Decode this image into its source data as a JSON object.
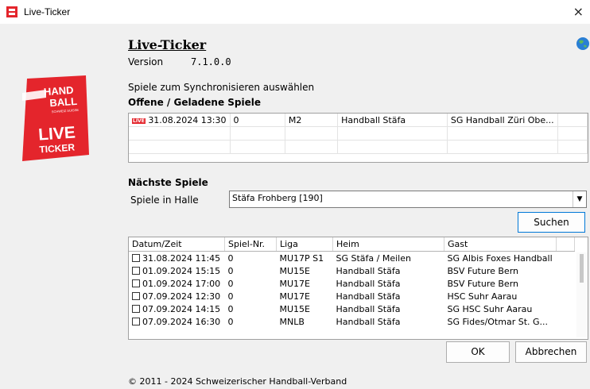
{
  "window": {
    "title": "Live-Ticker",
    "close_glyph": "×"
  },
  "header": {
    "title": "Live-Ticker",
    "version_label": "Version",
    "version_value": "7.1.0.0"
  },
  "logo": {
    "top": "HAND",
    "bottom": "BALL",
    "sub": "SCHWEIZ SUISSE",
    "live": "LIVE",
    "ticker": "TICKER",
    "accent": "#e4252c"
  },
  "sync": {
    "prompt": "Spiele zum Synchronisieren auswählen",
    "open_heading": "Offene / Geladene Spiele"
  },
  "open_games": [
    {
      "badge": "LIVE",
      "datetime": "31.08.2024 13:30",
      "nr": "0",
      "liga": "M2",
      "heim": "Handball Stäfa",
      "gast": "SG Handball Züri Obe..."
    }
  ],
  "next": {
    "heading": "Nächste Spiele",
    "hall_label": "Spiele in Halle",
    "hall_value": "Stäfa Frohberg [190]",
    "search_button": "Suchen"
  },
  "games_table": {
    "columns": [
      "Datum/Zeit",
      "Spiel-Nr.",
      "Liga",
      "Heim",
      "Gast"
    ],
    "rows": [
      [
        "31.08.2024 11:45",
        "0",
        "MU17P S1",
        "SG Stäfa / Meilen",
        "SG Albis Foxes Handball"
      ],
      [
        "01.09.2024 15:15",
        "0",
        "MU15E",
        "Handball Stäfa",
        "BSV Future Bern"
      ],
      [
        "01.09.2024 17:00",
        "0",
        "MU17E",
        "Handball Stäfa",
        "BSV Future Bern"
      ],
      [
        "07.09.2024 12:30",
        "0",
        "MU17E",
        "Handball Stäfa",
        "HSC Suhr Aarau"
      ],
      [
        "07.09.2024 14:15",
        "0",
        "MU15E",
        "Handball Stäfa",
        "SG HSC Suhr Aarau"
      ],
      [
        "07.09.2024 16:30",
        "0",
        "MNLB",
        "Handball Stäfa",
        "SG Fides/Otmar St. G..."
      ]
    ]
  },
  "buttons": {
    "ok": "OK",
    "cancel": "Abbrechen"
  },
  "footer": {
    "copyright": "© 2011 - 2024 Schweizerischer Handball-Verband"
  }
}
